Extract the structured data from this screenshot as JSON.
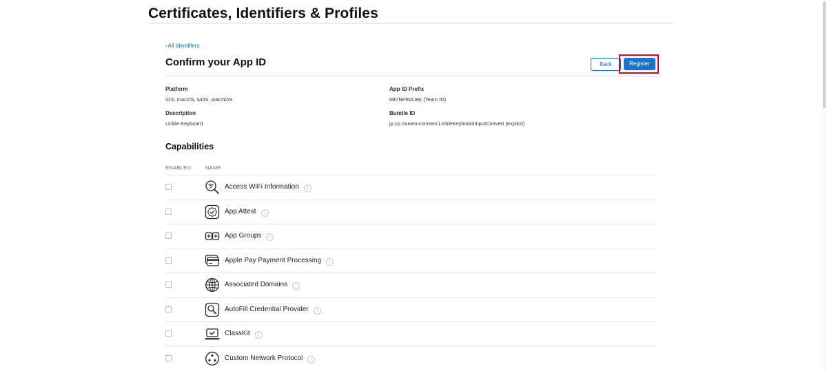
{
  "header": {
    "title": "Certificates, Identifiers & Profiles"
  },
  "nav": {
    "back_link": "All Identifiers"
  },
  "section": {
    "title": "Confirm your App ID"
  },
  "buttons": {
    "back": "Back",
    "register": "Register"
  },
  "details": {
    "platform_label": "Platform",
    "platform_value": "iOS, macOS, tvOS, watchOS",
    "prefix_label": "App ID Prefix",
    "prefix_value": "6B7NP8VLBK (Team ID)",
    "description_label": "Description",
    "description_value": "Linble Keyboard",
    "bundle_label": "Bundle ID",
    "bundle_value": "jp.cp.musen-connect.LinbleKeyboardInputConvert (explicit)"
  },
  "capabilities": {
    "title": "Capabilities",
    "col_enabled": "ENABLED",
    "col_name": "NAME",
    "items": [
      {
        "name": "Access WiFi Information",
        "icon": "wifi-search-icon",
        "enabled": false
      },
      {
        "name": "App Attest",
        "icon": "app-attest-icon",
        "enabled": false
      },
      {
        "name": "App Groups",
        "icon": "app-groups-icon",
        "enabled": false
      },
      {
        "name": "Apple Pay Payment Processing",
        "icon": "apple-pay-card-icon",
        "enabled": false
      },
      {
        "name": "Associated Domains",
        "icon": "globe-icon",
        "enabled": false
      },
      {
        "name": "AutoFill Credential Provider",
        "icon": "key-icon",
        "enabled": false
      },
      {
        "name": "ClassKit",
        "icon": "classkit-laptop-icon",
        "enabled": false
      },
      {
        "name": "Custom Network Protocol",
        "icon": "network-protocol-icon",
        "enabled": false
      }
    ]
  },
  "colors": {
    "accent": "#0070c9",
    "register_bg": "#1a73cf",
    "highlight": "#e2001a"
  }
}
